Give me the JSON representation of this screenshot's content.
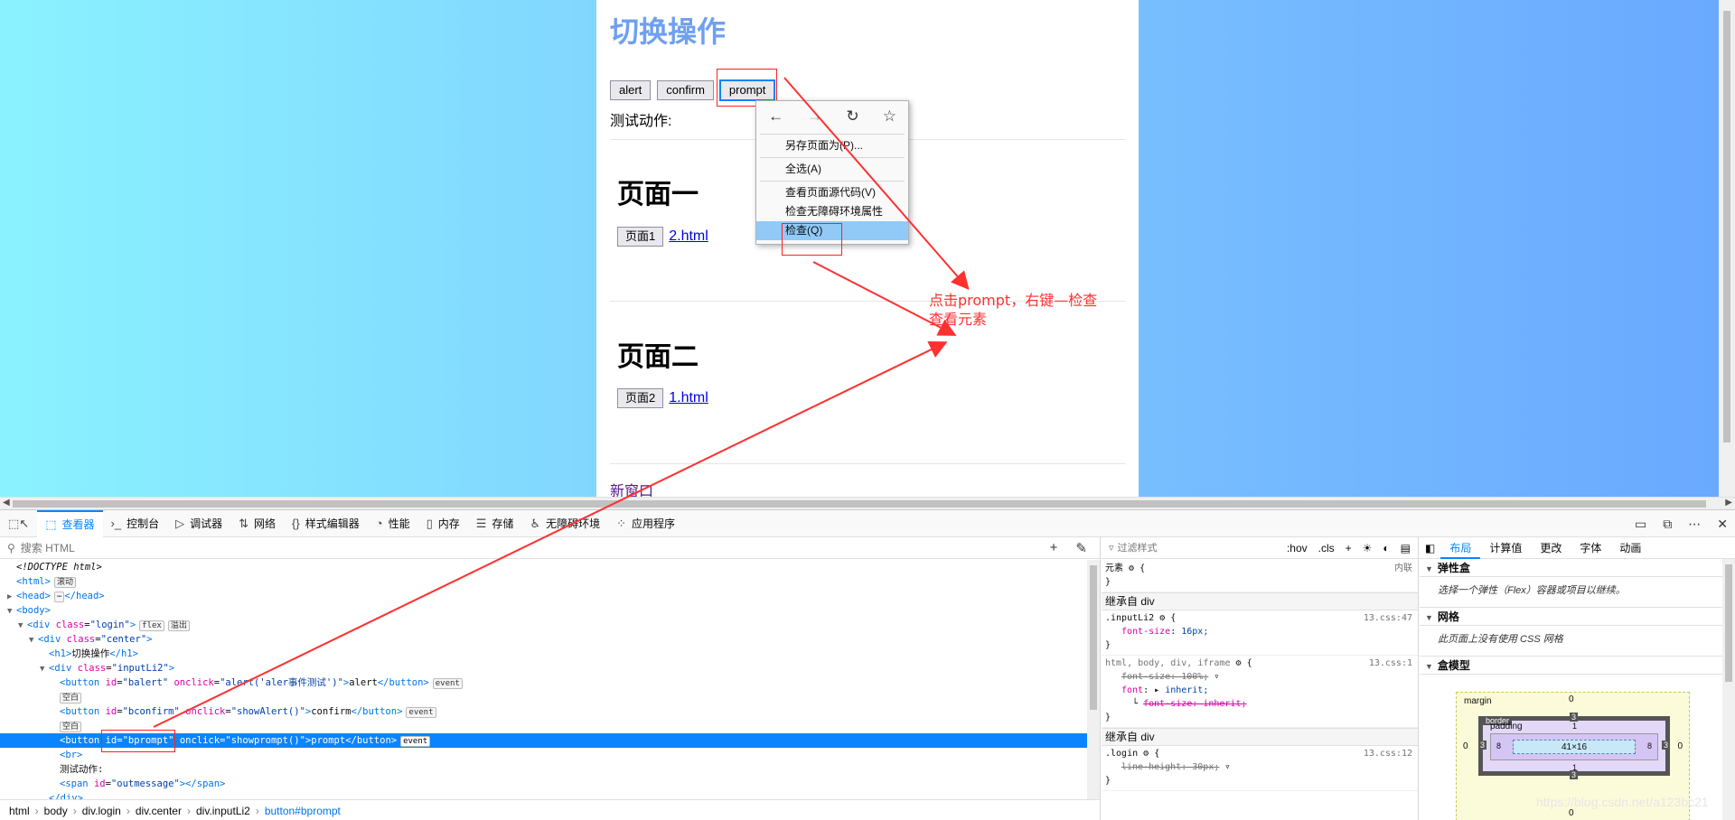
{
  "page": {
    "heading": "切换操作",
    "buttons": [
      "alert",
      "confirm",
      "prompt"
    ],
    "test_label": "测试动作:",
    "section1": {
      "title": "页面一",
      "button": "页面1",
      "link": "2.html"
    },
    "section2": {
      "title": "页面二",
      "button": "页面2",
      "link": "1.html"
    },
    "new_window_link": "新窗口"
  },
  "context_menu": {
    "nav": [
      "←",
      "→",
      "↻",
      "☆"
    ],
    "items": [
      "另存页面为(P)...",
      "全选(A)",
      "查看页面源代码(V)",
      "检查无障碍环境属性",
      "检查(Q)"
    ]
  },
  "annotation": {
    "line1": "点击prompt，右键—检查",
    "line2": "查看元素"
  },
  "devtools": {
    "tabs": [
      {
        "icon": "⬚",
        "label": "查看器"
      },
      {
        "icon": "›_",
        "label": "控制台"
      },
      {
        "icon": "▷",
        "label": "调试器"
      },
      {
        "icon": "⇅",
        "label": "网络"
      },
      {
        "icon": "{}",
        "label": "样式编辑器"
      },
      {
        "icon": "◔",
        "label": "性能"
      },
      {
        "icon": "▯",
        "label": "内存"
      },
      {
        "icon": "☰",
        "label": "存储"
      },
      {
        "icon": "♿",
        "label": "无障碍环境"
      },
      {
        "icon": "⁘",
        "label": "应用程序"
      }
    ],
    "search_placeholder": "搜索 HTML",
    "markup": [
      {
        "indent": 1,
        "html": "<i>&lt;!DOCTYPE html&gt;</i>"
      },
      {
        "indent": 1,
        "html": "<span class='t'>&lt;html&gt;</span><span class='badge'>滚动</span>"
      },
      {
        "indent": 1,
        "tw": "▶",
        "html": "<span class='t'>&lt;head&gt;</span><span class='badge'>⋯</span><span class='t'>&lt;/head&gt;</span>"
      },
      {
        "indent": 1,
        "tw": "▼",
        "html": "<span class='t'>&lt;body&gt;</span>"
      },
      {
        "indent": 2,
        "tw": "▼",
        "html": "<span class='t'>&lt;div</span> <span class='a'>class</span>=<span class='v'>\"login\"</span><span class='t'>&gt;</span><span class='badge'>flex</span><span class='badge'>溢出</span>"
      },
      {
        "indent": 3,
        "tw": "▼",
        "html": "<span class='t'>&lt;div</span> <span class='a'>class</span>=<span class='v'>\"center\"</span><span class='t'>&gt;</span>"
      },
      {
        "indent": 4,
        "html": "<span class='t'>&lt;h1&gt;</span>切换操作<span class='t'>&lt;/h1&gt;</span>"
      },
      {
        "indent": 4,
        "tw": "▼",
        "html": "<span class='t'>&lt;div</span> <span class='a'>class</span>=<span class='v'>\"inputLi2\"</span><span class='t'>&gt;</span>"
      },
      {
        "indent": 5,
        "html": "<span class='t'>&lt;button</span> <span class='a'>id</span>=<span class='v'>\"balert\"</span> <span class='a'>onclick</span>=<span class='v'>\"alert('aler事件测试')\"</span><span class='t'>&gt;</span>alert<span class='t'>&lt;/button&gt;</span><span class='badge'>event</span>"
      },
      {
        "indent": 5,
        "html": "<span class='badge' style='margin-left:0'>空白</span>"
      },
      {
        "indent": 5,
        "html": "<span class='t'>&lt;button</span> <span class='a'>id</span>=<span class='v'>\"bconfirm\"</span> <span class='a'>onclick</span>=<span class='v'>\"showAlert()\"</span><span class='t'>&gt;</span>confirm<span class='t'>&lt;/button&gt;</span><span class='badge'>event</span>"
      },
      {
        "indent": 5,
        "html": "<span class='badge' style='margin-left:0'>空白</span>"
      },
      {
        "indent": 5,
        "sel": true,
        "html": "<span class='t'>&lt;button</span> <span class='a'>id</span>=<span class='v'>\"bprompt\"</span> <span class='a'>onclick</span>=<span class='v'>\"showprompt()\"</span><span class='t'>&gt;</span>prompt<span class='t'>&lt;/button&gt;</span><span class='badge'>event</span>"
      },
      {
        "indent": 5,
        "html": "<span class='t'>&lt;br&gt;</span>"
      },
      {
        "indent": 5,
        "html": "测试动作:"
      },
      {
        "indent": 5,
        "html": "<span class='t'>&lt;span</span> <span class='a'>id</span>=<span class='v'>\"outmessage\"</span><span class='t'>&gt;&lt;/span&gt;</span>"
      },
      {
        "indent": 4,
        "html": "<span class='t'>&lt;/div&gt;</span>"
      }
    ],
    "breadcrumbs": [
      "html",
      "body",
      "div.login",
      "div.center",
      "div.inputLi2",
      "button#bprompt"
    ],
    "rules": {
      "filter_placeholder": "过滤样式",
      "tools": [
        ":hov",
        ".cls",
        "+",
        "☀",
        "◐",
        "▤"
      ],
      "element_selector": "元素",
      "element_inline": "内联",
      "inherit_heading_1": "继承自 div",
      "inherit_heading_2": "继承自 div",
      "rule1": {
        "selector": ".inputLi2",
        "source": "13.css:47",
        "prop": "font-size",
        "value": "16px;"
      },
      "rule2": {
        "selector": "html, body, div, iframe",
        "source": "13.css:1",
        "p1": "font-size: 100%;",
        "p2_name": "font",
        "p2_value": "inherit;",
        "p3": "font-size: inherit;"
      },
      "rule3": {
        "selector": ".login",
        "source": "13.css:12",
        "p1": "line-height: 30px;"
      }
    },
    "layout": {
      "tabs": [
        "布局",
        "计算值",
        "更改",
        "字体",
        "动画"
      ],
      "flex_title": "弹性盒",
      "flex_desc": "选择一个弹性（Flex）容器或项目以继续。",
      "grid_title": "网格",
      "grid_desc": "此页面上没有使用 CSS 网格",
      "boxmodel_title": "盒模型",
      "box": {
        "margin_label": "margin",
        "border_label": "border",
        "padding_label": "padding",
        "content": "41×16",
        "m_top": "0",
        "m_left": "0",
        "m_right": "0",
        "m_bottom": "0",
        "b_top": "3",
        "b_left": "3",
        "b_right": "3",
        "b_bottom": "3",
        "p_top": "1",
        "p_left": "8",
        "p_right": "8",
        "p_bottom": "1"
      }
    }
  },
  "watermark": "https://blog.csdn.net/a123bc21"
}
